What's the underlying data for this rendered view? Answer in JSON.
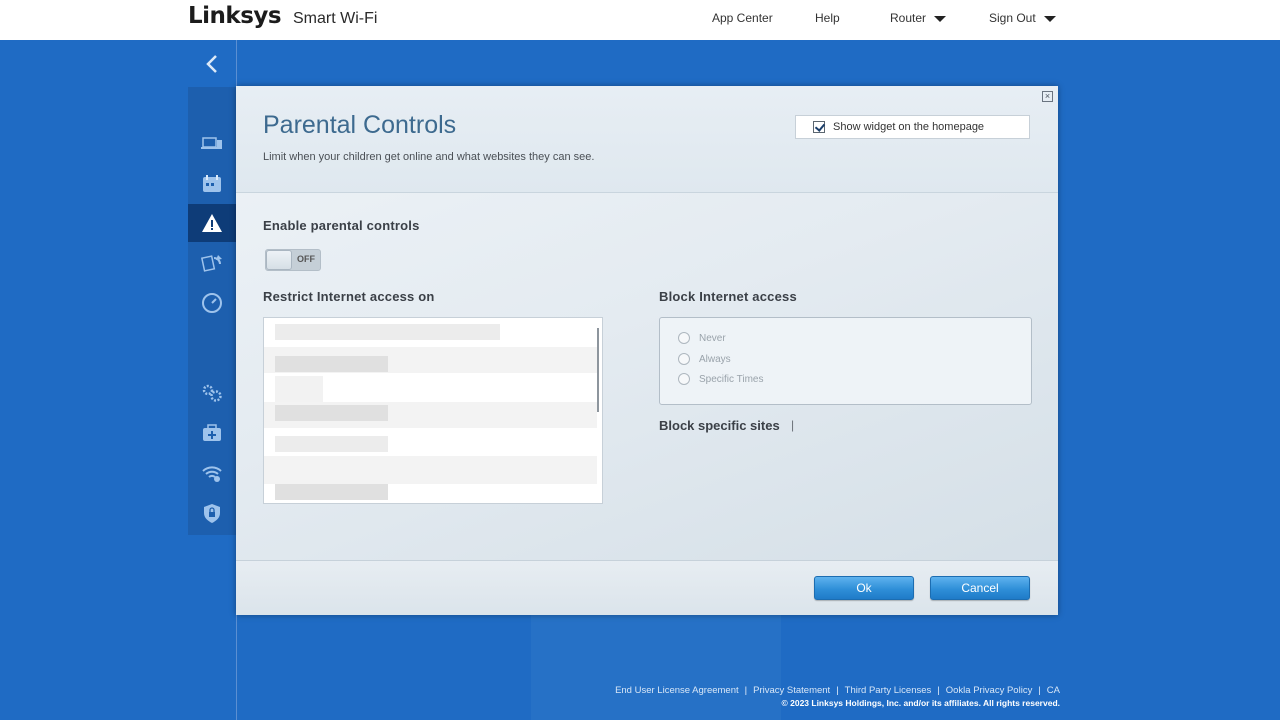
{
  "header": {
    "logo": "Linksys",
    "product": "Smart Wi-Fi",
    "nav": {
      "app_center": "App Center",
      "help": "Help",
      "router": "Router",
      "sign_out": "Sign Out"
    }
  },
  "sidebar": {
    "icons": [
      "devices-icon",
      "calendar-icon",
      "parental-controls-icon",
      "media-icon",
      "speed-test-icon",
      "settings-icon",
      "troubleshooting-icon",
      "wifi-settings-icon",
      "security-icon"
    ],
    "active": "parental-controls-icon"
  },
  "modal": {
    "title": "Parental Controls",
    "subtitle": "Limit when your children get online and what websites they can see.",
    "show_widget_label": "Show widget on the homepage",
    "show_widget_checked": true,
    "enable_label": "Enable parental controls",
    "toggle_state": "OFF",
    "restrict_label": "Restrict Internet access on",
    "block_label": "Block Internet access",
    "block_options": [
      "Never",
      "Always",
      "Specific Times"
    ],
    "block_sites_label": "Block specific sites",
    "block_sites_pipe": "|",
    "ok_label": "Ok",
    "cancel_label": "Cancel"
  },
  "footer": {
    "links": [
      "End User License Agreement",
      "Privacy Statement",
      "Third Party Licenses",
      "Ookla Privacy Policy",
      "CA"
    ],
    "copyright": "© 2023 Linksys Holdings, Inc. and/or its affiliates. All rights reserved."
  },
  "colors": {
    "background": "#1f6bc4",
    "title": "#3d6a8f",
    "button": "#2f8fd8"
  }
}
